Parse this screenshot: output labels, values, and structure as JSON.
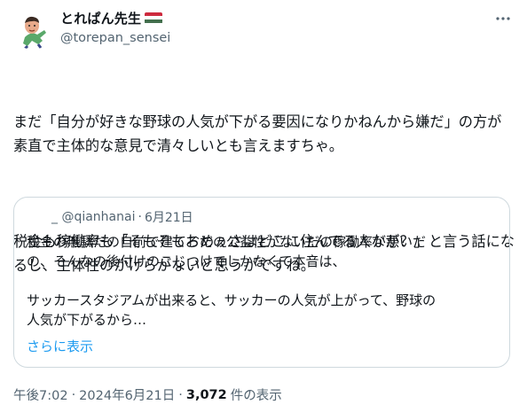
{
  "author": {
    "display_name": "とれぱん先生",
    "handle": "@torepan_sensei",
    "flag_colors": [
      "#CD2A3E",
      "#FFFFFF",
      "#436F4D"
    ]
  },
  "tweet": {
    "paragraphs": [
      "まだ「自分が好きな野球の人気が下がる要因になりかねんから嫌だ」の方が素直で主体的な意見で清々しいとも言えますちゃ。",
      "税金も稼働率も「そもそもおめぇさはどこに住んでる人なが？」と言う話になるし、主体性のかけらがないと思うがですね。"
    ]
  },
  "quote": {
    "handle": "_ @qianhanai",
    "separator": "·",
    "date": "6月21日",
    "lines": [
      "税金の無駄だの自前で建てろだの公益性がないだの稼働率が悪いだ",
      "の、そんなの後付けのこじつけでしかなくて本音は、",
      "",
      "サッカースタジアムが出来ると、サッカーの人気が上がって、野球の",
      "人気が下がるから…"
    ],
    "show_more": "さらに表示"
  },
  "meta": {
    "time": "午後7:02",
    "sep1": "·",
    "date": "2024年6月21日",
    "sep2": "·",
    "views_count": "3,072",
    "views_label": "件の表示"
  },
  "colors": {
    "text": "#0f1419",
    "secondary": "#536471",
    "link": "#1d9bf0",
    "border": "#cfd9de"
  },
  "icons": {
    "more": "more-horizontal-icon"
  }
}
